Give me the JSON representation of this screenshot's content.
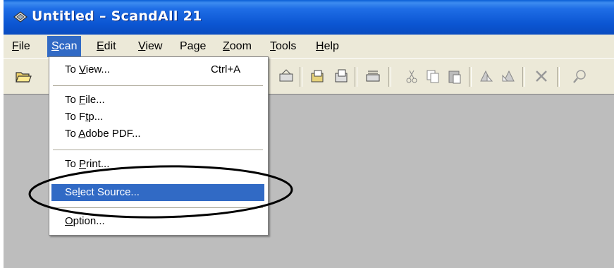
{
  "window": {
    "title": "Untitled – ScandAll 21"
  },
  "menubar": {
    "items": [
      {
        "pre": "",
        "key": "F",
        "post": "ile"
      },
      {
        "pre": "",
        "key": "S",
        "post": "can"
      },
      {
        "pre": "",
        "key": "E",
        "post": "dit"
      },
      {
        "pre": "",
        "key": "V",
        "post": "iew"
      },
      {
        "pre": "Pa",
        "key": "g",
        "post": "e"
      },
      {
        "pre": "",
        "key": "Z",
        "post": "oom"
      },
      {
        "pre": "",
        "key": "T",
        "post": "ools"
      },
      {
        "pre": "",
        "key": "H",
        "post": "elp"
      }
    ]
  },
  "scan_menu": {
    "items": [
      {
        "pre": "To ",
        "key": "V",
        "post": "iew...",
        "shortcut": "Ctrl+A"
      },
      {
        "pre": "To ",
        "key": "F",
        "post": "ile..."
      },
      {
        "pre": "To F",
        "key": "t",
        "post": "p..."
      },
      {
        "pre": "To ",
        "key": "A",
        "post": "dobe PDF..."
      },
      {
        "pre": "To ",
        "key": "P",
        "post": "rint..."
      },
      {
        "pre": "Se",
        "key": "l",
        "post": "ect Source..."
      },
      {
        "pre": "",
        "key": "O",
        "post": "ption..."
      }
    ],
    "highlighted_index": 5
  },
  "colors": {
    "titlebar": "#0b55d2",
    "menu_highlight": "#316ac5",
    "workspace": "#bdbdbd"
  },
  "icons": {
    "title": "scanner-app-icon",
    "toolbar": [
      "open-folder-icon",
      "scan-icon",
      "scan-batch-icon",
      "scan-page-icon",
      "scan-insert-icon",
      "cut-icon",
      "copy-icon",
      "paste-icon",
      "rotate-left-icon",
      "rotate-right-icon",
      "delete-icon",
      "zoom-icon"
    ]
  }
}
